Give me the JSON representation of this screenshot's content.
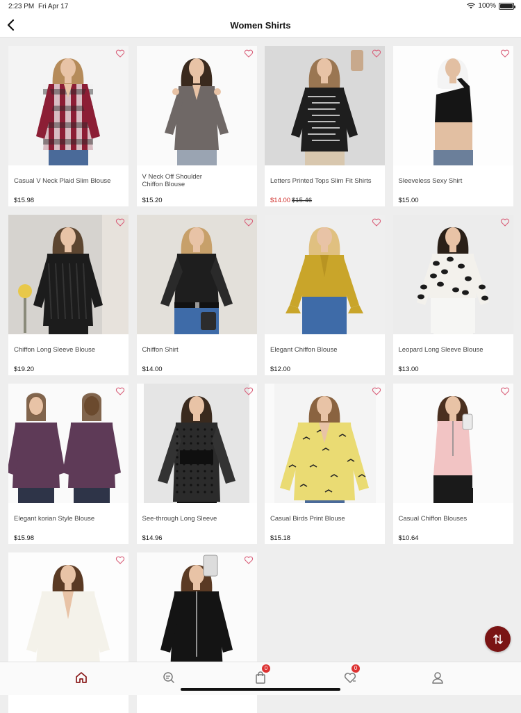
{
  "status": {
    "time": "2:23 PM",
    "date": "Fri Apr 17",
    "battery": "100%"
  },
  "nav": {
    "title": "Women Shirts"
  },
  "products": [
    {
      "name": "Casual V Neck Plaid Slim Blouse",
      "price": "$15.98",
      "old_price": "",
      "on_sale": false,
      "art": "plaid"
    },
    {
      "name": "V Neck Off Shoulder Chiffon Blouse",
      "price": "$15.20",
      "old_price": "",
      "on_sale": false,
      "art": "grey"
    },
    {
      "name": "Letters Printed Tops Slim Fit Shirts",
      "price": "$14.00",
      "old_price": "$15.46",
      "on_sale": true,
      "art": "letters"
    },
    {
      "name": "Sleeveless Sexy Shirt",
      "price": "$15.00",
      "old_price": "",
      "on_sale": false,
      "art": "crop"
    },
    {
      "name": "Chiffon Long Sleeve Blouse",
      "price": "$19.20",
      "old_price": "",
      "on_sale": false,
      "art": "blackknit"
    },
    {
      "name": "Chiffon Shirt",
      "price": "$14.00",
      "old_price": "",
      "on_sale": false,
      "art": "sheer"
    },
    {
      "name": "Elegant Chiffon Blouse",
      "price": "$12.00",
      "old_price": "",
      "on_sale": false,
      "art": "mustard"
    },
    {
      "name": "Leopard Long Sleeve Blouse",
      "price": "$13.00",
      "old_price": "",
      "on_sale": false,
      "art": "leopard"
    },
    {
      "name": "Elegant korian Style Blouse",
      "price": "$15.98",
      "old_price": "",
      "on_sale": false,
      "art": "purple"
    },
    {
      "name": "See-through Long Sleeve",
      "price": "$14.96",
      "old_price": "",
      "on_sale": false,
      "art": "dotsheer"
    },
    {
      "name": "Casual Birds Print Blouse",
      "price": "$15.18",
      "old_price": "",
      "on_sale": false,
      "art": "birds"
    },
    {
      "name": "Casual Chiffon Blouses",
      "price": "$10.64",
      "old_price": "",
      "on_sale": false,
      "art": "pink"
    },
    {
      "name": "",
      "price": "",
      "old_price": "",
      "on_sale": false,
      "art": "white"
    },
    {
      "name": "",
      "price": "",
      "old_price": "",
      "on_sale": false,
      "art": "blackzip"
    }
  ],
  "tabbar": {
    "cart_count": "0",
    "wishlist_count": "0",
    "icons": [
      "home-icon",
      "search-list-icon",
      "shopping-bag-icon",
      "wishlist-heart-icon",
      "user-icon"
    ]
  },
  "colors": {
    "accent": "#7a1414",
    "sale": "#d0312d",
    "badge": "#dd3333",
    "heart": "#d9607a"
  }
}
